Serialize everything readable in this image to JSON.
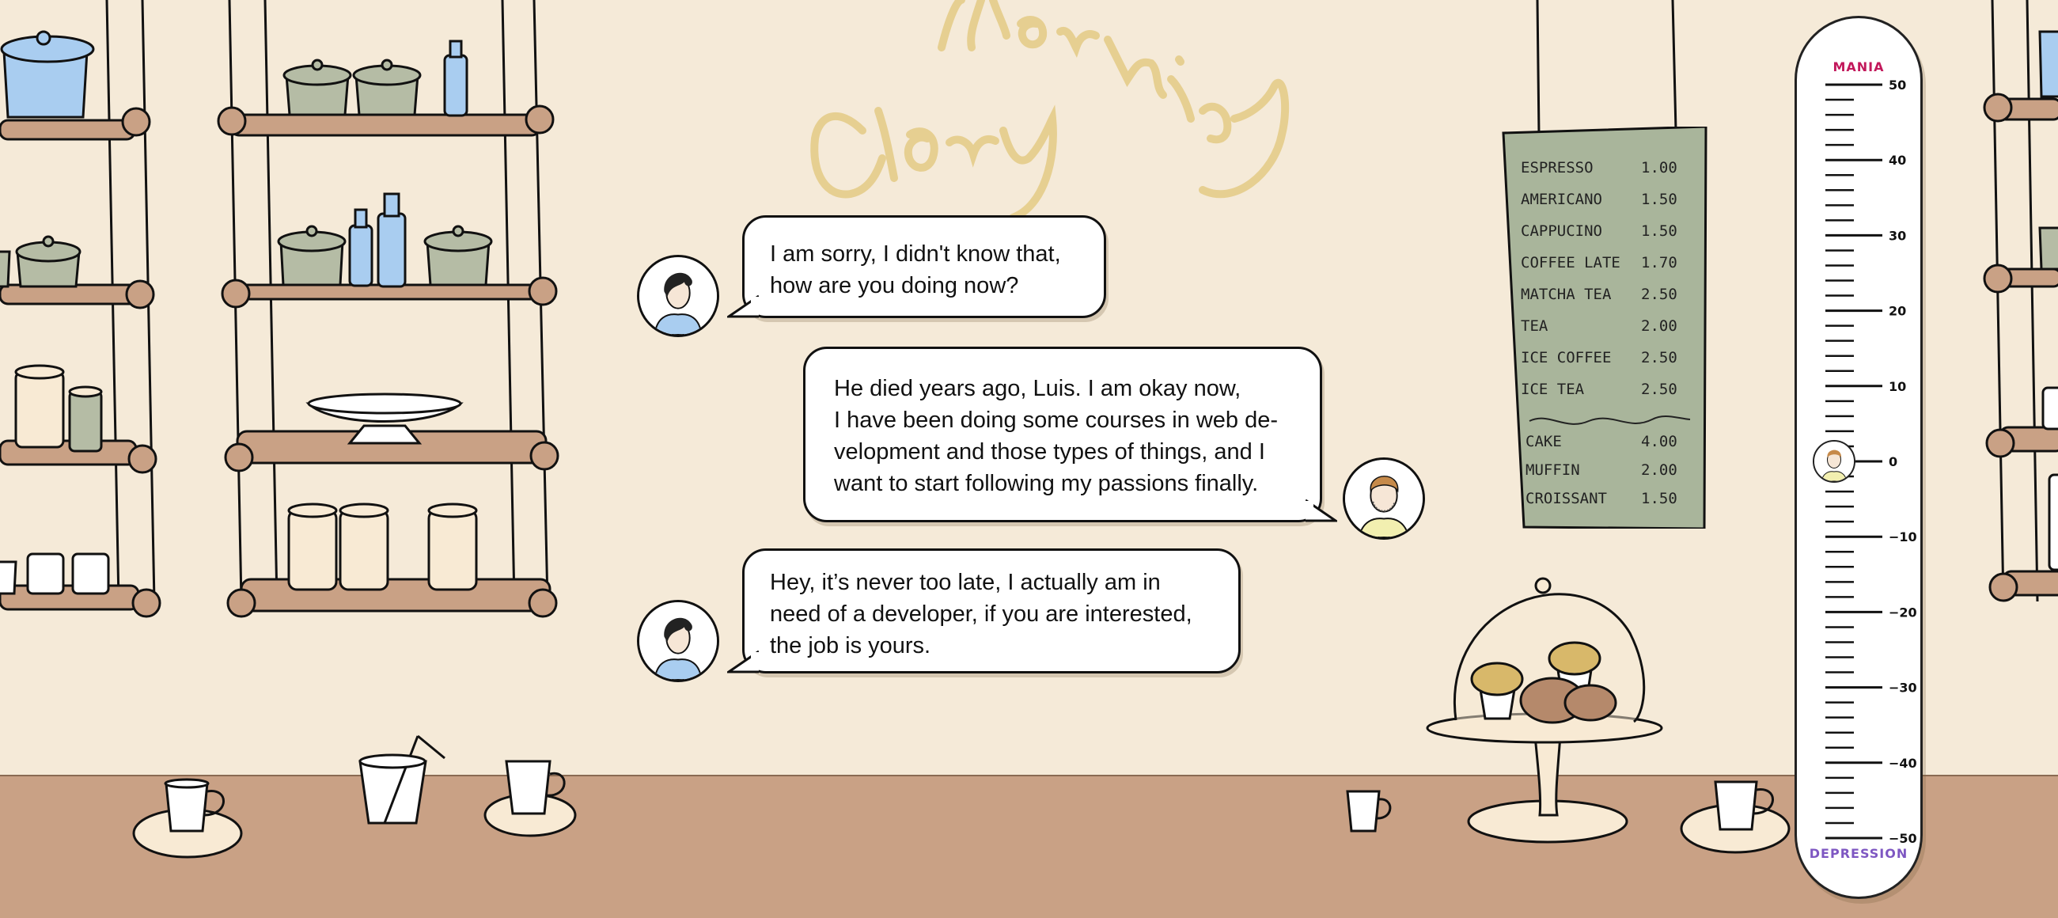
{
  "title_sign": {
    "line1": "Morning",
    "line2": "Glory"
  },
  "dialogue": [
    {
      "speaker": "woman",
      "lines": [
        "I am sorry, I didn't know that,",
        "how are you doing now?"
      ]
    },
    {
      "speaker": "luis",
      "lines": [
        "He died years ago, Luis. I am okay now,",
        "I have been doing some courses in web de-",
        "velopment and those types of things, and I",
        "want to start following my passions finally."
      ]
    },
    {
      "speaker": "woman",
      "lines": [
        "Hey, it’s never too late, I actually am in",
        "need of a developer, if you are interested,",
        "the job is yours."
      ]
    }
  ],
  "menu": {
    "items": [
      {
        "name": "ESPRESSO",
        "price": "1.00"
      },
      {
        "name": "AMERICANO",
        "price": "1.50"
      },
      {
        "name": "CAPPUCINO",
        "price": "1.50"
      },
      {
        "name": "COFFEE LATE",
        "price": "1.70"
      },
      {
        "name": "MATCHA TEA",
        "price": "2.50"
      },
      {
        "name": "TEA",
        "price": "2.00"
      },
      {
        "name": "ICE COFFEE",
        "price": "2.50"
      },
      {
        "name": "ICE TEA",
        "price": "2.50"
      }
    ],
    "extras": [
      {
        "name": "CAKE",
        "price": "4.00"
      },
      {
        "name": "MUFFIN",
        "price": "2.00"
      },
      {
        "name": "CROISSANT",
        "price": "1.50"
      }
    ]
  },
  "mood_meter": {
    "top_label": "MANIA",
    "bottom_label": "DEPRESSION",
    "top_color": "#c2185b",
    "bottom_color": "#7e57c2",
    "tick_labels": [
      "50",
      "40",
      "30",
      "20",
      "10",
      "0",
      "−10",
      "−20",
      "−30",
      "−40",
      "−50"
    ],
    "value": 0,
    "marker": "luis-avatar"
  },
  "colors": {
    "wall": "#f5ead8",
    "counter": "#c9a185",
    "shelf": "#c9a185",
    "jar_green": "#b5bca5",
    "glass_blue": "#a9cdf0",
    "menu_board": "#a9b59b",
    "sign": "#e5cd8a"
  }
}
